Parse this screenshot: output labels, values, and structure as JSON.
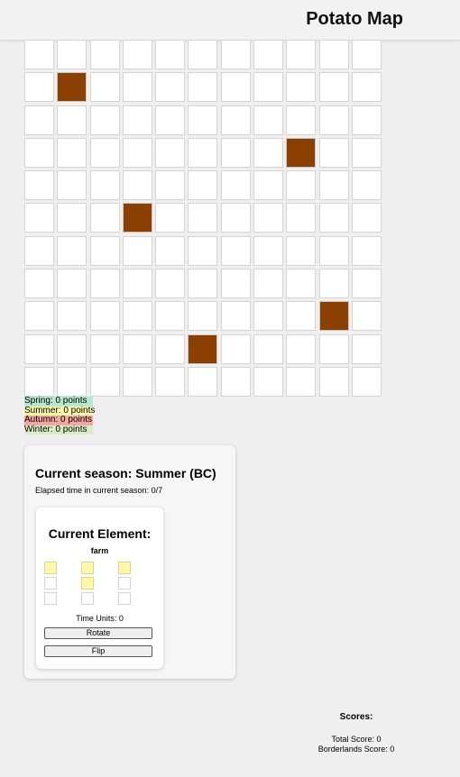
{
  "header": {
    "title": "Potato Map"
  },
  "map": {
    "rows": 11,
    "cols": 11,
    "mountains": [
      [
        1,
        1
      ],
      [
        3,
        8
      ],
      [
        5,
        3
      ],
      [
        8,
        9
      ],
      [
        9,
        5
      ]
    ],
    "mountain_color": "#8b4000"
  },
  "seasons": [
    {
      "label": "Spring: 0 points",
      "color": "#b6e8cf"
    },
    {
      "label": "Summer: 0 points",
      "color": "#fff8a6"
    },
    {
      "label": "Autumn: 0 points",
      "color": "#f3a7a0"
    },
    {
      "label": "Winter: 0 points",
      "color": "#d9edc3"
    }
  ],
  "panel": {
    "current_season": "Current season:  Summer (BC)",
    "elapsed": "Elapsed time in current season: 0/7",
    "element": {
      "title": "Current Element:",
      "type": "farm",
      "shape": [
        [
          1,
          1,
          1
        ],
        [
          0,
          1,
          0
        ],
        [
          0,
          0,
          0
        ]
      ],
      "fill_color": "#fff8a6",
      "time_units": "Time Units: 0",
      "rotate_label": "Rotate",
      "flip_label": "Flip"
    }
  },
  "scores": {
    "title": "Scores:",
    "total": "Total Score: 0",
    "borderlands": "Borderlands Score: 0"
  }
}
